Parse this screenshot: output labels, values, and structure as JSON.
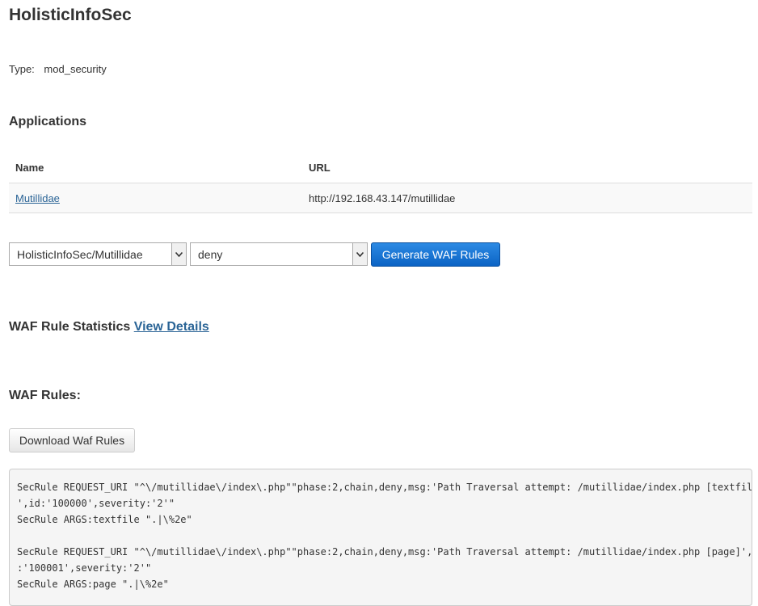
{
  "page": {
    "title": "HolisticInfoSec",
    "type_label": "Type:",
    "type_value": "mod_security"
  },
  "applications": {
    "heading": "Applications",
    "columns": [
      "Name",
      "URL"
    ],
    "rows": [
      {
        "name": "Mutillidae",
        "url": "http://192.168.43.147/mutillidae"
      }
    ]
  },
  "controls": {
    "app_select_value": "HolisticInfoSec/Mutillidae",
    "action_select_value": "deny",
    "generate_button": "Generate WAF Rules"
  },
  "stats": {
    "label": "WAF Rule Statistics",
    "link": "View Details"
  },
  "rules": {
    "heading": "WAF Rules:",
    "download_button": "Download Waf Rules",
    "lines": [
      "SecRule REQUEST_URI \"^\\/mutillidae\\/index\\.php\"\"phase:2,chain,deny,msg:'Path Traversal attempt: /mutillidae/index.php [textfile]",
      "',id:'100000',severity:'2'\"",
      "SecRule ARGS:textfile \".|\\%2e\"",
      "",
      "SecRule REQUEST_URI \"^\\/mutillidae\\/index\\.php\"\"phase:2,chain,deny,msg:'Path Traversal attempt: /mutillidae/index.php [page]',id",
      ":'100001',severity:'2'\"",
      "SecRule ARGS:page \".|\\%2e\""
    ]
  },
  "colors": {
    "link": "#2a6496",
    "primary_button": "#0b63c4",
    "code_background": "#f5f5f5"
  },
  "icons": {
    "select_arrow": "chevron-down-icon"
  }
}
